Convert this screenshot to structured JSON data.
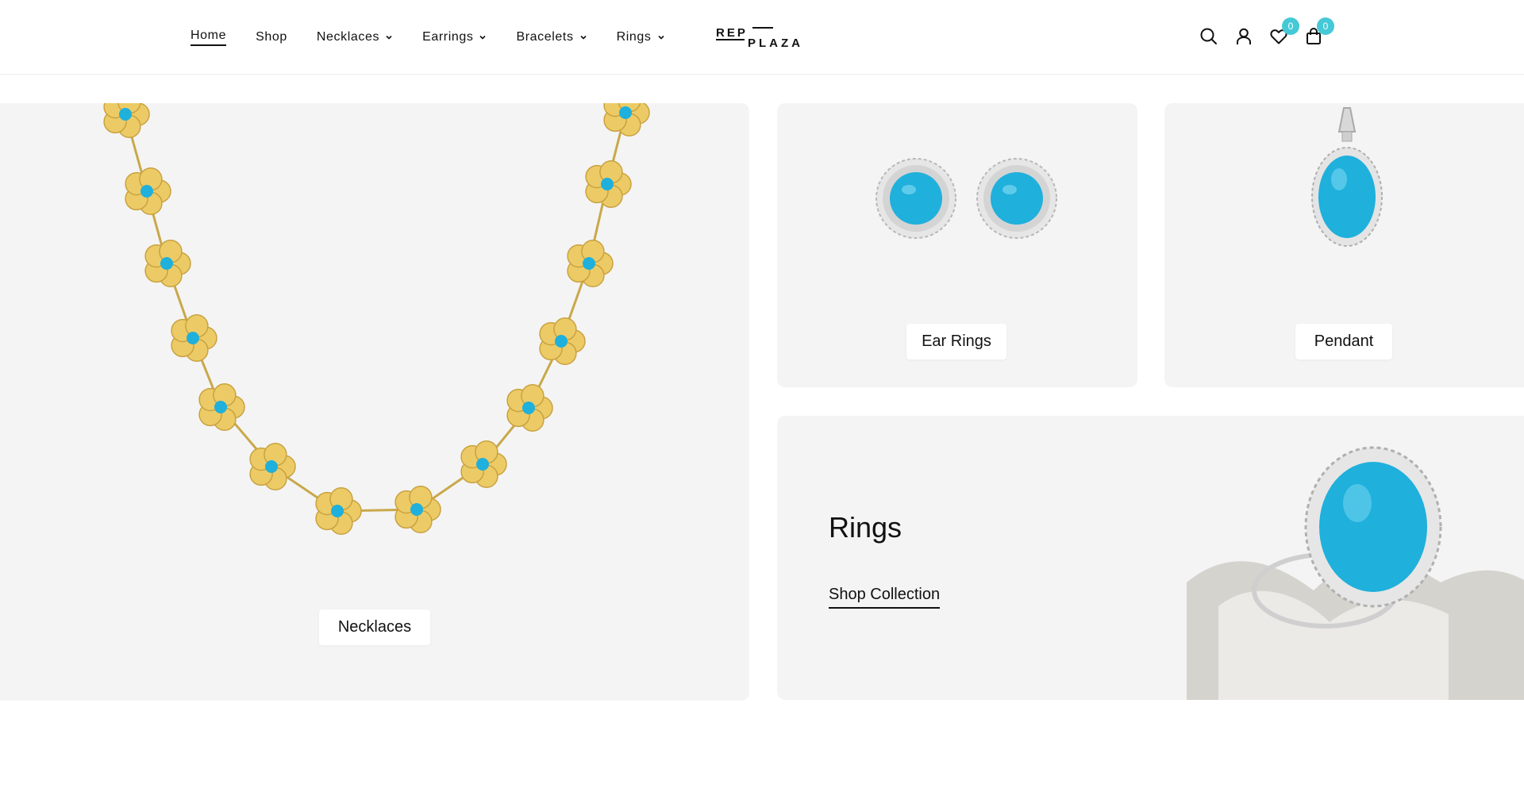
{
  "header": {
    "nav": [
      {
        "label": "Home",
        "active": true,
        "dropdown": false
      },
      {
        "label": "Shop",
        "active": false,
        "dropdown": false
      },
      {
        "label": "Necklaces",
        "active": false,
        "dropdown": true
      },
      {
        "label": "Earrings",
        "active": false,
        "dropdown": true
      },
      {
        "label": "Bracelets",
        "active": false,
        "dropdown": true
      },
      {
        "label": "Rings",
        "active": false,
        "dropdown": true
      }
    ],
    "logo": {
      "top": "REP",
      "bottom": "PLAZA"
    },
    "icons": [
      "search-icon",
      "account-icon",
      "wishlist-icon",
      "cart-icon"
    ],
    "wishlist_count": "0",
    "cart_count": "0"
  },
  "categories": {
    "necklaces_label": "Necklaces",
    "earrings_label": "Ear Rings",
    "pendant_label": "Pendant",
    "rings_title": "Rings",
    "rings_link": "Shop Collection"
  },
  "colors": {
    "accent": "#45c9d6",
    "panel_bg": "#f4f4f4",
    "turquoise": "#1fb0dc",
    "gold": "#e8c35a"
  }
}
